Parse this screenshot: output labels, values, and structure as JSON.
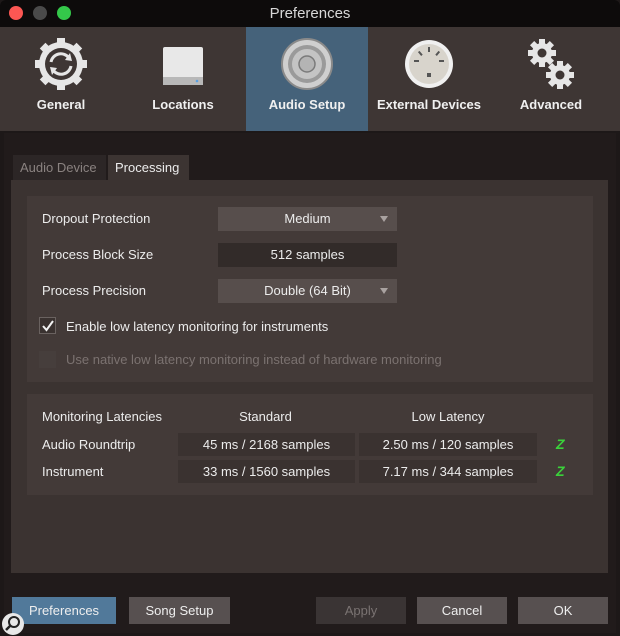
{
  "window": {
    "title": "Preferences"
  },
  "toolbar": {
    "items": [
      {
        "label": "General",
        "icon": "sync-gear-icon",
        "selected": false
      },
      {
        "label": "Locations",
        "icon": "drive-icon",
        "selected": false
      },
      {
        "label": "Audio Setup",
        "icon": "speaker-icon",
        "selected": true
      },
      {
        "label": "External Devices",
        "icon": "midi-port-icon",
        "selected": false
      },
      {
        "label": "Advanced",
        "icon": "gears-icon",
        "selected": false
      }
    ]
  },
  "tabs": [
    {
      "label": "Audio Device",
      "active": false
    },
    {
      "label": "Processing",
      "active": true
    }
  ],
  "processing": {
    "dropout_protection": {
      "label": "Dropout Protection",
      "value": "Medium"
    },
    "block_size": {
      "label": "Process Block Size",
      "value": "512 samples"
    },
    "precision": {
      "label": "Process Precision",
      "value": "Double (64 Bit)"
    },
    "low_latency_checkbox": {
      "label": "Enable low latency monitoring for instruments",
      "checked": true
    },
    "native_checkbox": {
      "label": "Use native low latency monitoring instead of hardware monitoring",
      "checked": false,
      "enabled": false
    }
  },
  "latencies": {
    "header": "Monitoring Latencies",
    "col_standard": "Standard",
    "col_low": "Low Latency",
    "rows": [
      {
        "label": "Audio Roundtrip",
        "standard": "45 ms / 2168 samples",
        "low": "2.50 ms / 120 samples",
        "indicator": "Z"
      },
      {
        "label": "Instrument",
        "standard": "33 ms / 1560 samples",
        "low": "7.17 ms / 344 samples",
        "indicator": "Z"
      }
    ]
  },
  "footer": {
    "preferences": "Preferences",
    "song_setup": "Song Setup",
    "apply": "Apply",
    "cancel": "Cancel",
    "ok": "OK"
  },
  "colors": {
    "accent": "#45627a",
    "indicator": "#3ad23a"
  }
}
